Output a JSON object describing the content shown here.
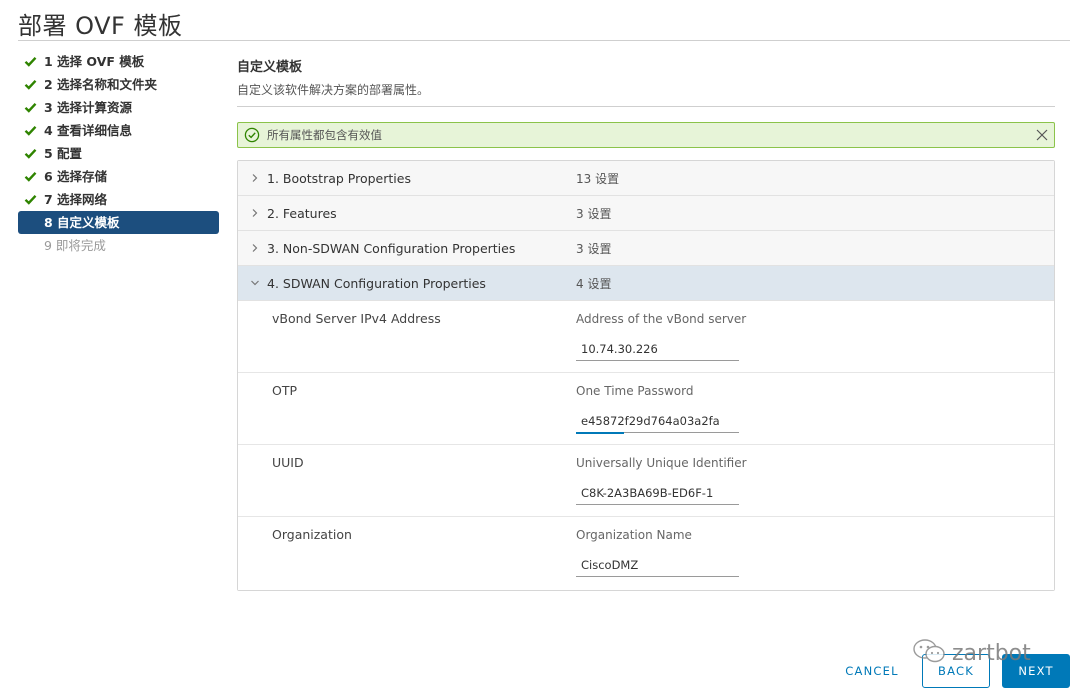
{
  "page": {
    "title": "部署 OVF 模板"
  },
  "steps": [
    {
      "label": "1 选择 OVF 模板",
      "state": "done"
    },
    {
      "label": "2 选择名称和文件夹",
      "state": "done"
    },
    {
      "label": "3 选择计算资源",
      "state": "done"
    },
    {
      "label": "4 查看详细信息",
      "state": "done"
    },
    {
      "label": "5 配置",
      "state": "done"
    },
    {
      "label": "6 选择存储",
      "state": "done"
    },
    {
      "label": "7 选择网络",
      "state": "done"
    },
    {
      "label": "8 自定义模板",
      "state": "active"
    },
    {
      "label": "9 即将完成",
      "state": "pending"
    }
  ],
  "section": {
    "title": "自定义模板",
    "subtitle": "自定义该软件解决方案的部署属性。"
  },
  "alert": {
    "text": "所有属性都包含有效值"
  },
  "groups": [
    {
      "label": "1. Bootstrap Properties",
      "count": "13 设置"
    },
    {
      "label": "2. Features",
      "count": "3 设置"
    },
    {
      "label": "3. Non-SDWAN Configuration Properties",
      "count": "3 设置"
    },
    {
      "label": "4. SDWAN Configuration Properties",
      "count": "4 设置"
    }
  ],
  "properties": [
    {
      "name": "vBond Server IPv4 Address",
      "description": "Address of the vBond server",
      "value": "10.74.30.226"
    },
    {
      "name": "OTP",
      "description": "One Time Password",
      "value": "e45872f29d764a03a2fa"
    },
    {
      "name": "UUID",
      "description": "Universally Unique Identifier",
      "value": "C8K-2A3BA69B-ED6F-1"
    },
    {
      "name": "Organization",
      "description": "Organization Name",
      "value": "CiscoDMZ"
    }
  ],
  "buttons": {
    "cancel": "CANCEL",
    "back": "BACK",
    "next": "NEXT"
  },
  "watermark": {
    "text": "zartbot"
  },
  "colors": {
    "accent": "#0079b8",
    "active_step": "#1c4e7e",
    "success": "#2f8400",
    "alert_bg": "#e7f4d8"
  },
  "icons": {
    "done": "check-icon",
    "alert": "check-circle-icon",
    "close": "close-icon",
    "collapsed": "chevron-right-icon",
    "expanded": "chevron-down-icon"
  }
}
